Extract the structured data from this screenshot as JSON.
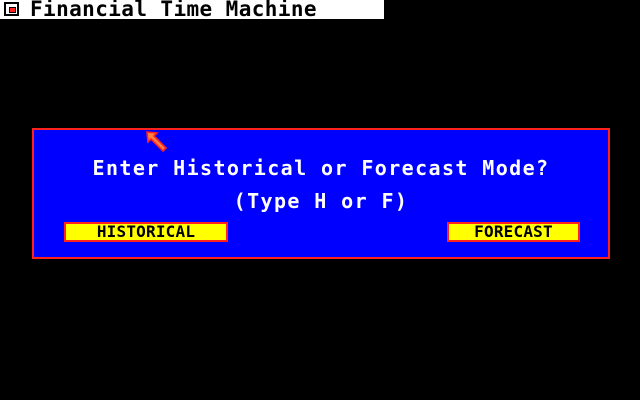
{
  "window": {
    "title": "Financial Time Machine",
    "close_icon": "close-box-icon"
  },
  "dialog": {
    "prompt": "Enter Historical or Forecast Mode?",
    "hint": "(Type H or F)",
    "buttons": {
      "historical": "HISTORICAL",
      "forecast": "FORECAST"
    }
  },
  "pointer": {
    "icon": "arrow-pointer-icon"
  },
  "colors": {
    "background": "#000000",
    "dialog_bg": "#0000ff",
    "dialog_border": "#ff2020",
    "button_bg": "#ffff00",
    "text": "#ffffff"
  }
}
